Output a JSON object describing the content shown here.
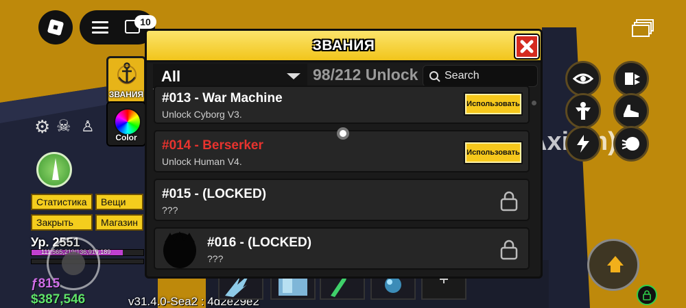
{
  "topbar": {
    "chat_badge": "10"
  },
  "side_tabs": [
    {
      "label": "ЗВАНИЯ"
    },
    {
      "label": "Color"
    }
  ],
  "left_menu": {
    "stats_label": "Статистика",
    "items_label": "Вещи",
    "close_label": "Закрыть",
    "shop_label": "Магазин"
  },
  "player": {
    "level": "Ур. 2551",
    "xp": "111,565,219/136,919,189",
    "xp_progress": 0.815,
    "fragments": "ƒ815",
    "money": "$387,546"
  },
  "version": "v31.4.0-Sea2 : 4d2e29e2",
  "background_text": "Axiom)",
  "modal": {
    "title": "ЗВАНИЯ",
    "filter": "All",
    "unlocked": "98/212 Unlock",
    "search_placeholder": "Search",
    "use_label": "Использовать",
    "rows": [
      {
        "title": "#013 - War Machine",
        "desc": "Unlock Cyborg V3.",
        "state": "use"
      },
      {
        "title": "#014 - Berserker",
        "desc": "Unlock Human V4.",
        "state": "use"
      },
      {
        "title": "#015 - (LOCKED)",
        "desc": "???",
        "state": "locked"
      },
      {
        "title": "#016 - (LOCKED)",
        "desc": "???",
        "state": "locked"
      }
    ]
  },
  "colors": {
    "accent_yellow": "#f4cd1d",
    "close_red": "#d42a1f",
    "highlight_red": "#e8332e",
    "money_green": "#5fe26a",
    "fragments_purple": "#d06ee8"
  },
  "icons": {
    "abilities": [
      "eye-icon",
      "dash-icon",
      "muscle-icon",
      "shoe-icon",
      "lightning-icon",
      "fist-icon"
    ]
  }
}
